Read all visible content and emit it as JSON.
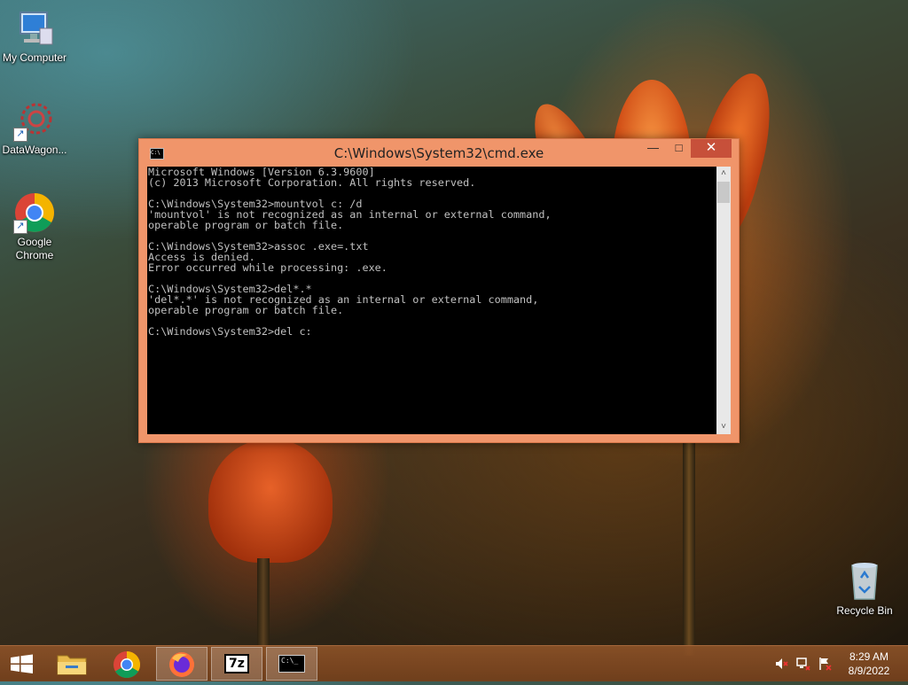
{
  "desktop": {
    "icons": [
      {
        "label": "My Computer",
        "icon": "computer-icon"
      },
      {
        "label": "DataWagon...",
        "icon": "datawagon-icon"
      },
      {
        "label": "Google Chrome",
        "icon": "chrome-icon"
      },
      {
        "label": "Recycle Bin",
        "icon": "recycle-bin-icon"
      }
    ]
  },
  "window": {
    "title": "C:\\Windows\\System32\\cmd.exe",
    "title_icon_text": "C:\\",
    "minimize_glyph": "—",
    "maximize_glyph": "□",
    "close_glyph": "✕",
    "console_lines": [
      "Microsoft Windows [Version 6.3.9600]",
      "(c) 2013 Microsoft Corporation. All rights reserved.",
      "",
      "C:\\Windows\\System32>mountvol c: /d",
      "'mountvol' is not recognized as an internal or external command,",
      "operable program or batch file.",
      "",
      "C:\\Windows\\System32>assoc .exe=.txt",
      "Access is denied.",
      "Error occurred while processing: .exe.",
      "",
      "C:\\Windows\\System32>del*.*",
      "'del*.*' is not recognized as an internal or external command,",
      "operable program or batch file.",
      "",
      "C:\\Windows\\System32>del c:"
    ],
    "scroll_up": "˄",
    "scroll_down": "˅"
  },
  "taskbar": {
    "items": [
      {
        "name": "start-button",
        "icon": "windows-logo-icon"
      },
      {
        "name": "file-explorer-button",
        "icon": "folder-icon"
      },
      {
        "name": "chrome-taskbar-button",
        "icon": "chrome-icon"
      },
      {
        "name": "firefox-taskbar-button",
        "icon": "firefox-icon"
      },
      {
        "name": "7zip-taskbar-button",
        "icon": "7zip-icon",
        "text": "7z"
      },
      {
        "name": "cmd-taskbar-button",
        "icon": "cmd-icon",
        "text": "C:\\_"
      }
    ],
    "tray": {
      "time": "8:29 AM",
      "date": "8/9/2022",
      "icons": [
        "volume-muted-icon",
        "network-icon",
        "action-center-flag-icon"
      ]
    }
  }
}
